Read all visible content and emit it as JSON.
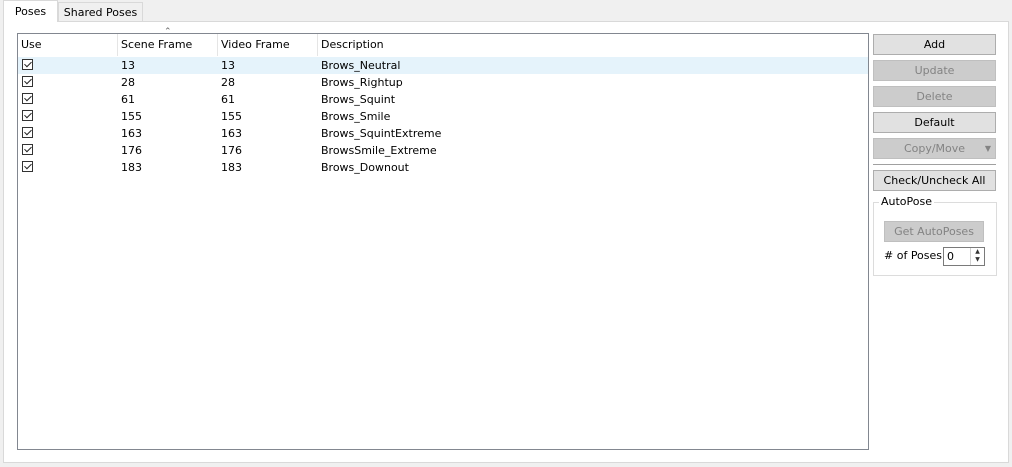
{
  "tabs": [
    {
      "label": "Poses",
      "active": true
    },
    {
      "label": "Shared Poses",
      "active": false
    }
  ],
  "list": {
    "columns": [
      "Use",
      "Scene Frame",
      "Video Frame",
      "Description"
    ],
    "rows": [
      {
        "use": true,
        "scene_frame": "13",
        "video_frame": "13",
        "description": "Brows_Neutral"
      },
      {
        "use": true,
        "scene_frame": "28",
        "video_frame": "28",
        "description": "Brows_Rightup"
      },
      {
        "use": true,
        "scene_frame": "61",
        "video_frame": "61",
        "description": "Brows_Squint"
      },
      {
        "use": true,
        "scene_frame": "155",
        "video_frame": "155",
        "description": "Brows_Smile"
      },
      {
        "use": true,
        "scene_frame": "163",
        "video_frame": "163",
        "description": "Brows_SquintExtreme"
      },
      {
        "use": true,
        "scene_frame": "176",
        "video_frame": "176",
        "description": "BrowsSmile_Extreme"
      },
      {
        "use": true,
        "scene_frame": "183",
        "video_frame": "183",
        "description": "Brows_Downout"
      }
    ]
  },
  "buttons": {
    "add": "Add",
    "update": "Update",
    "delete": "Delete",
    "default": "Default",
    "copy_move": "Copy/Move",
    "check_uncheck_all": "Check/Uncheck All"
  },
  "autopose": {
    "group_label": "AutoPose",
    "get_button": "Get AutoPoses",
    "num_poses_label": "# of Poses:",
    "num_poses_value": "0"
  },
  "colors": {
    "selected_row": "#e5f3fb",
    "button_face": "#e1e1e1",
    "disabled_text": "#838383"
  }
}
